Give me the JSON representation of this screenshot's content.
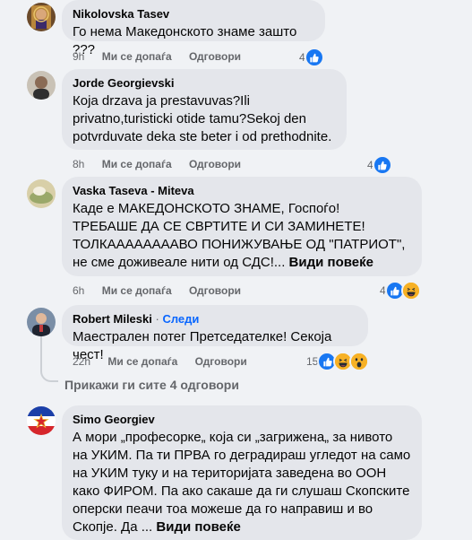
{
  "comments": [
    {
      "author": "Nikolovska Tasev",
      "text": "Го нема Македонското знаме зашто ???",
      "time": "9h",
      "like_label": "Ми се допаѓа",
      "reply_label": "Одговори",
      "reactions": "4"
    },
    {
      "author": "Jorde Georgievski",
      "text": "Која drzava ja prestavuvas?Ili privatno,turisticki otide tamu?Sekoj den potvrduvate deka ste beter i od prethodnite.",
      "time": "8h",
      "like_label": "Ми се допаѓа",
      "reply_label": "Одговори",
      "reactions": "4"
    },
    {
      "author": "Vaska Taseva - Miteva",
      "text": "Каде е МАКЕДОНСКОТО ЗНАМЕ, Госпоѓо!\nТРЕБАШЕ ДА СЕ СВРТИТЕ И СИ ЗАМИНЕТЕ!\nТОЛКААААААААВО ПОНИЖУВАЊЕ ОД \"ПАТРИОТ\", не сме доживеале нити од СДС!... ",
      "see_more": "Види повеќе",
      "time": "6h",
      "like_label": "Ми се допаѓа",
      "reply_label": "Одговори",
      "reactions": "4"
    },
    {
      "author": "Robert Mileski",
      "dot": "·",
      "follow": "Следи",
      "text": "Маестрален потег Претседателке! Секоја чест!",
      "time": "22h",
      "like_label": "Ми се допаѓа",
      "reply_label": "Одговори",
      "reactions": "15"
    },
    {
      "author": "Simo Georgiev",
      "text": "А мори „професорке„ која си „загрижена„ за нивото на УКИМ. Па ти ПРВА го деградираш угледот на само на УКИМ туку и на територијата заведена во ООН како ФИРОМ. Па ако сакаше да ги слушаш Скопските оперски пеачи тоа можеше да го направиш и во Скопје. Да ... ",
      "see_more": "Види повеќе"
    }
  ],
  "show_all_replies": "Прикажи ги сите 4 одговори",
  "icons": {
    "like": "like-icon",
    "haha": "haha-icon",
    "wow": "wow-icon"
  },
  "colors": {
    "background": "#f0f2f5",
    "bubble": "#e4e6eb",
    "like_blue": "#1877f2",
    "follow_blue": "#0866ff",
    "meta_gray": "#65676b"
  }
}
